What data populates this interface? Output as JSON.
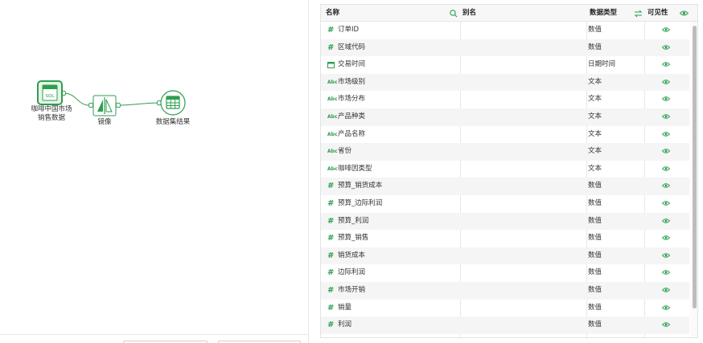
{
  "flow": {
    "nodes": [
      {
        "label_line1": "咖啡中国市场",
        "label_line2": "销售数据",
        "icon": "sql-source-icon",
        "badge": "SQL"
      },
      {
        "label": "镜像",
        "icon": "mirror-icon"
      },
      {
        "label": "数据集结果",
        "icon": "table-result-icon"
      }
    ]
  },
  "table": {
    "headers": {
      "name": "名称",
      "alias": "别名",
      "data_type": "数据类型",
      "visibility": "可见性"
    },
    "rows": [
      {
        "type_icon": "numeric-icon",
        "glyph": "#",
        "name": "订单ID",
        "alias": "",
        "data_type": "数值"
      },
      {
        "type_icon": "numeric-icon",
        "glyph": "#",
        "name": "区域代码",
        "alias": "",
        "data_type": "数值"
      },
      {
        "type_icon": "calendar-icon",
        "glyph": "",
        "name": "交易时间",
        "alias": "",
        "data_type": "日期时间"
      },
      {
        "type_icon": "text-type-icon",
        "glyph": "Abc",
        "name": "市场级别",
        "alias": "",
        "data_type": "文本"
      },
      {
        "type_icon": "text-type-icon",
        "glyph": "Abc",
        "name": "市场分布",
        "alias": "",
        "data_type": "文本"
      },
      {
        "type_icon": "text-type-icon",
        "glyph": "Abc",
        "name": "产品种类",
        "alias": "",
        "data_type": "文本"
      },
      {
        "type_icon": "text-type-icon",
        "glyph": "Abc",
        "name": "产品名称",
        "alias": "",
        "data_type": "文本"
      },
      {
        "type_icon": "text-type-icon",
        "glyph": "Abc",
        "name": "省份",
        "alias": "",
        "data_type": "文本"
      },
      {
        "type_icon": "text-type-icon",
        "glyph": "Abc",
        "name": "咖啡因类型",
        "alias": "",
        "data_type": "文本"
      },
      {
        "type_icon": "numeric-icon",
        "glyph": "#",
        "name": "预算_销货成本",
        "alias": "",
        "data_type": "数值"
      },
      {
        "type_icon": "numeric-icon",
        "glyph": "#",
        "name": "预算_边际利润",
        "alias": "",
        "data_type": "数值"
      },
      {
        "type_icon": "numeric-icon",
        "glyph": "#",
        "name": "预算_利润",
        "alias": "",
        "data_type": "数值"
      },
      {
        "type_icon": "numeric-icon",
        "glyph": "#",
        "name": "预算_销售",
        "alias": "",
        "data_type": "数值"
      },
      {
        "type_icon": "numeric-icon",
        "glyph": "#",
        "name": "销货成本",
        "alias": "",
        "data_type": "数值"
      },
      {
        "type_icon": "numeric-icon",
        "glyph": "#",
        "name": "边际利润",
        "alias": "",
        "data_type": "数值"
      },
      {
        "type_icon": "numeric-icon",
        "glyph": "#",
        "name": "市场开销",
        "alias": "",
        "data_type": "数值"
      },
      {
        "type_icon": "numeric-icon",
        "glyph": "#",
        "name": "销量",
        "alias": "",
        "data_type": "数值"
      },
      {
        "type_icon": "numeric-icon",
        "glyph": "#",
        "name": "利润",
        "alias": "",
        "data_type": "数值"
      }
    ]
  },
  "colors": {
    "accent_green": "#2e9e4f",
    "header_bg": "#f7f7f7",
    "row_alt_bg": "#f5f5f5"
  }
}
